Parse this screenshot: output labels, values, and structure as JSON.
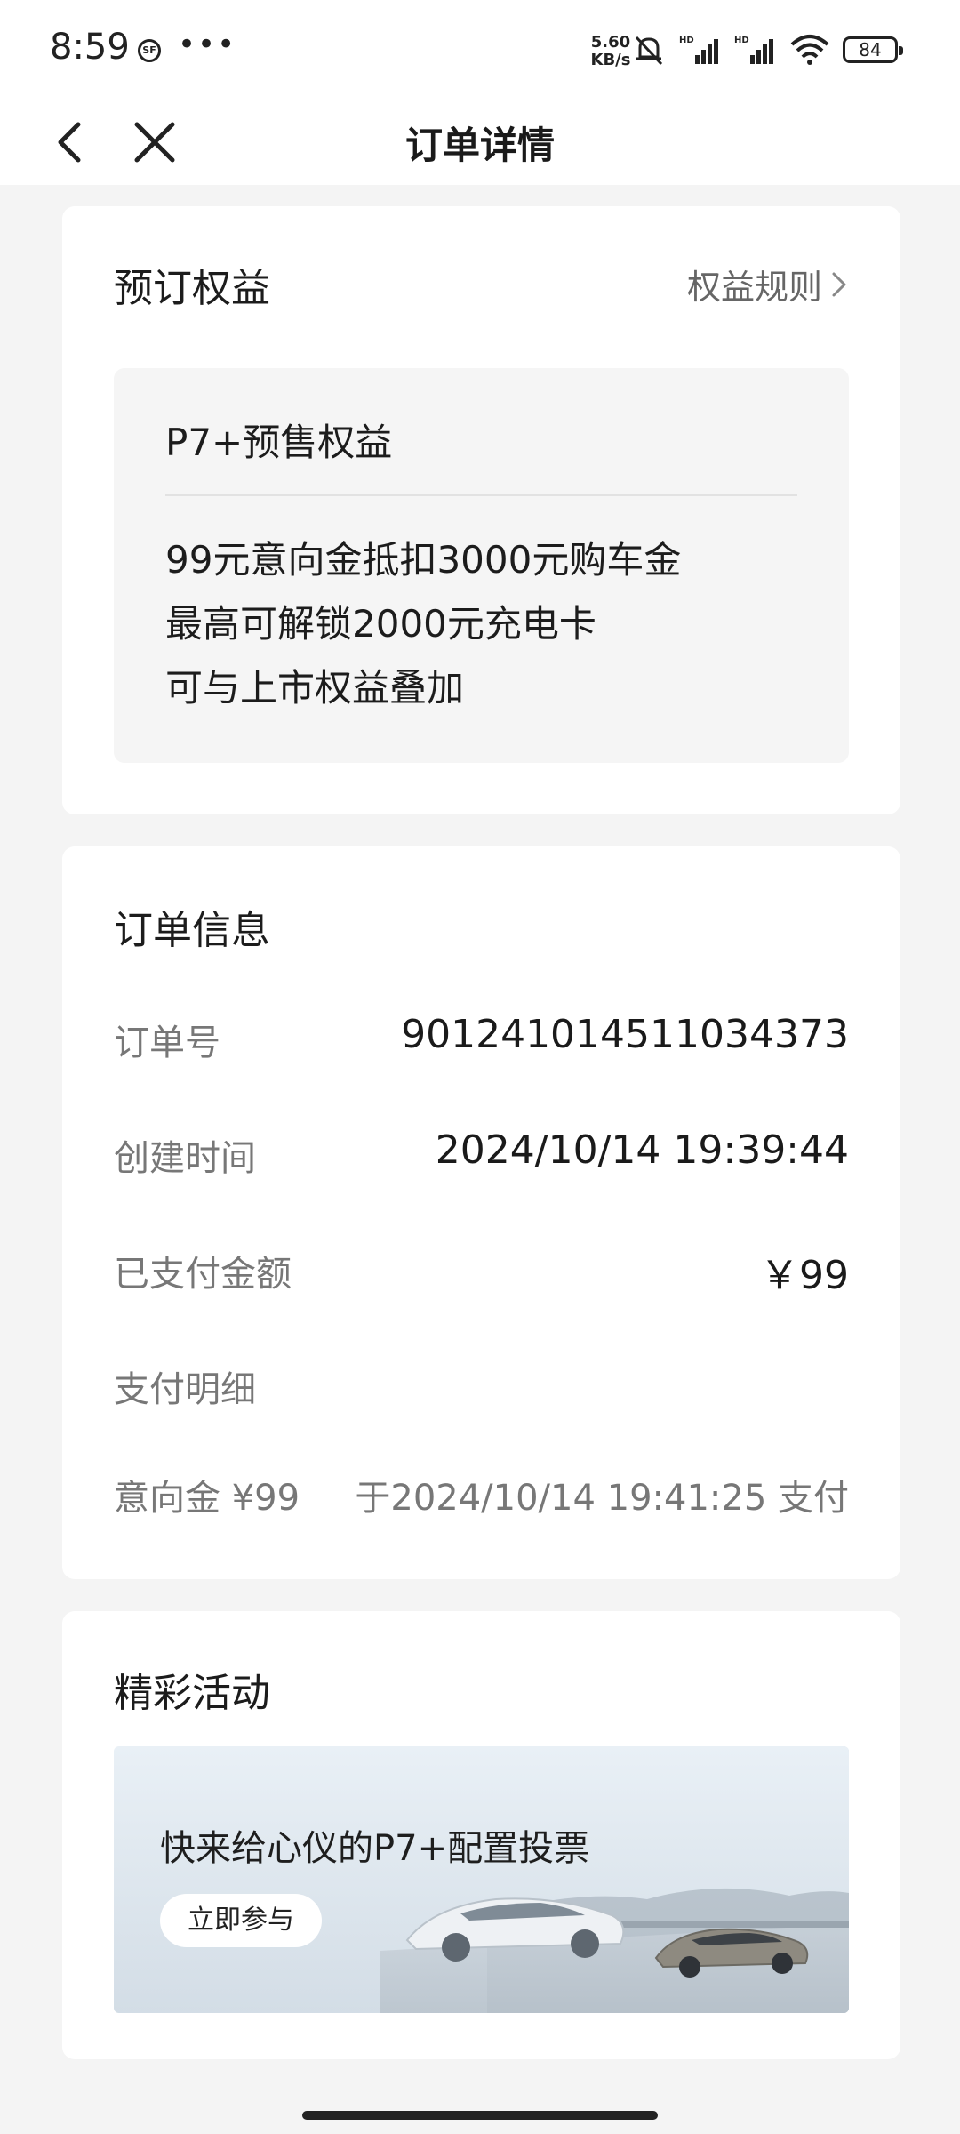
{
  "status_bar": {
    "time": "8:59",
    "sf_badge": "SF",
    "dots": "•••",
    "speed_value": "5.60",
    "speed_unit": "KB/s",
    "battery": "84"
  },
  "nav": {
    "title": "订单详情"
  },
  "benefits": {
    "title": "预订权益",
    "rules_link": "权益规则",
    "box_title": "P7+预售权益",
    "lines": [
      "99元意向金抵扣3000元购车金",
      "最高可解锁2000元充电卡",
      "可与上市权益叠加"
    ]
  },
  "order": {
    "title": "订单信息",
    "order_no_label": "订单号",
    "order_no": "901241014511034373",
    "created_label": "创建时间",
    "created": "2024/10/14 19:39:44",
    "paid_label": "已支付金额",
    "paid": "￥99",
    "detail_label": "支付明细",
    "deposit_label": "意向金 ¥99",
    "deposit_time": "于2024/10/14 19:41:25 支付"
  },
  "activity": {
    "title": "精彩活动",
    "banner_text": "快来给心仪的P7+配置投票",
    "banner_button": "立即参与"
  },
  "icons": {
    "back": "chevron-left-icon",
    "close": "close-icon",
    "rules": "chevron-right-icon"
  }
}
